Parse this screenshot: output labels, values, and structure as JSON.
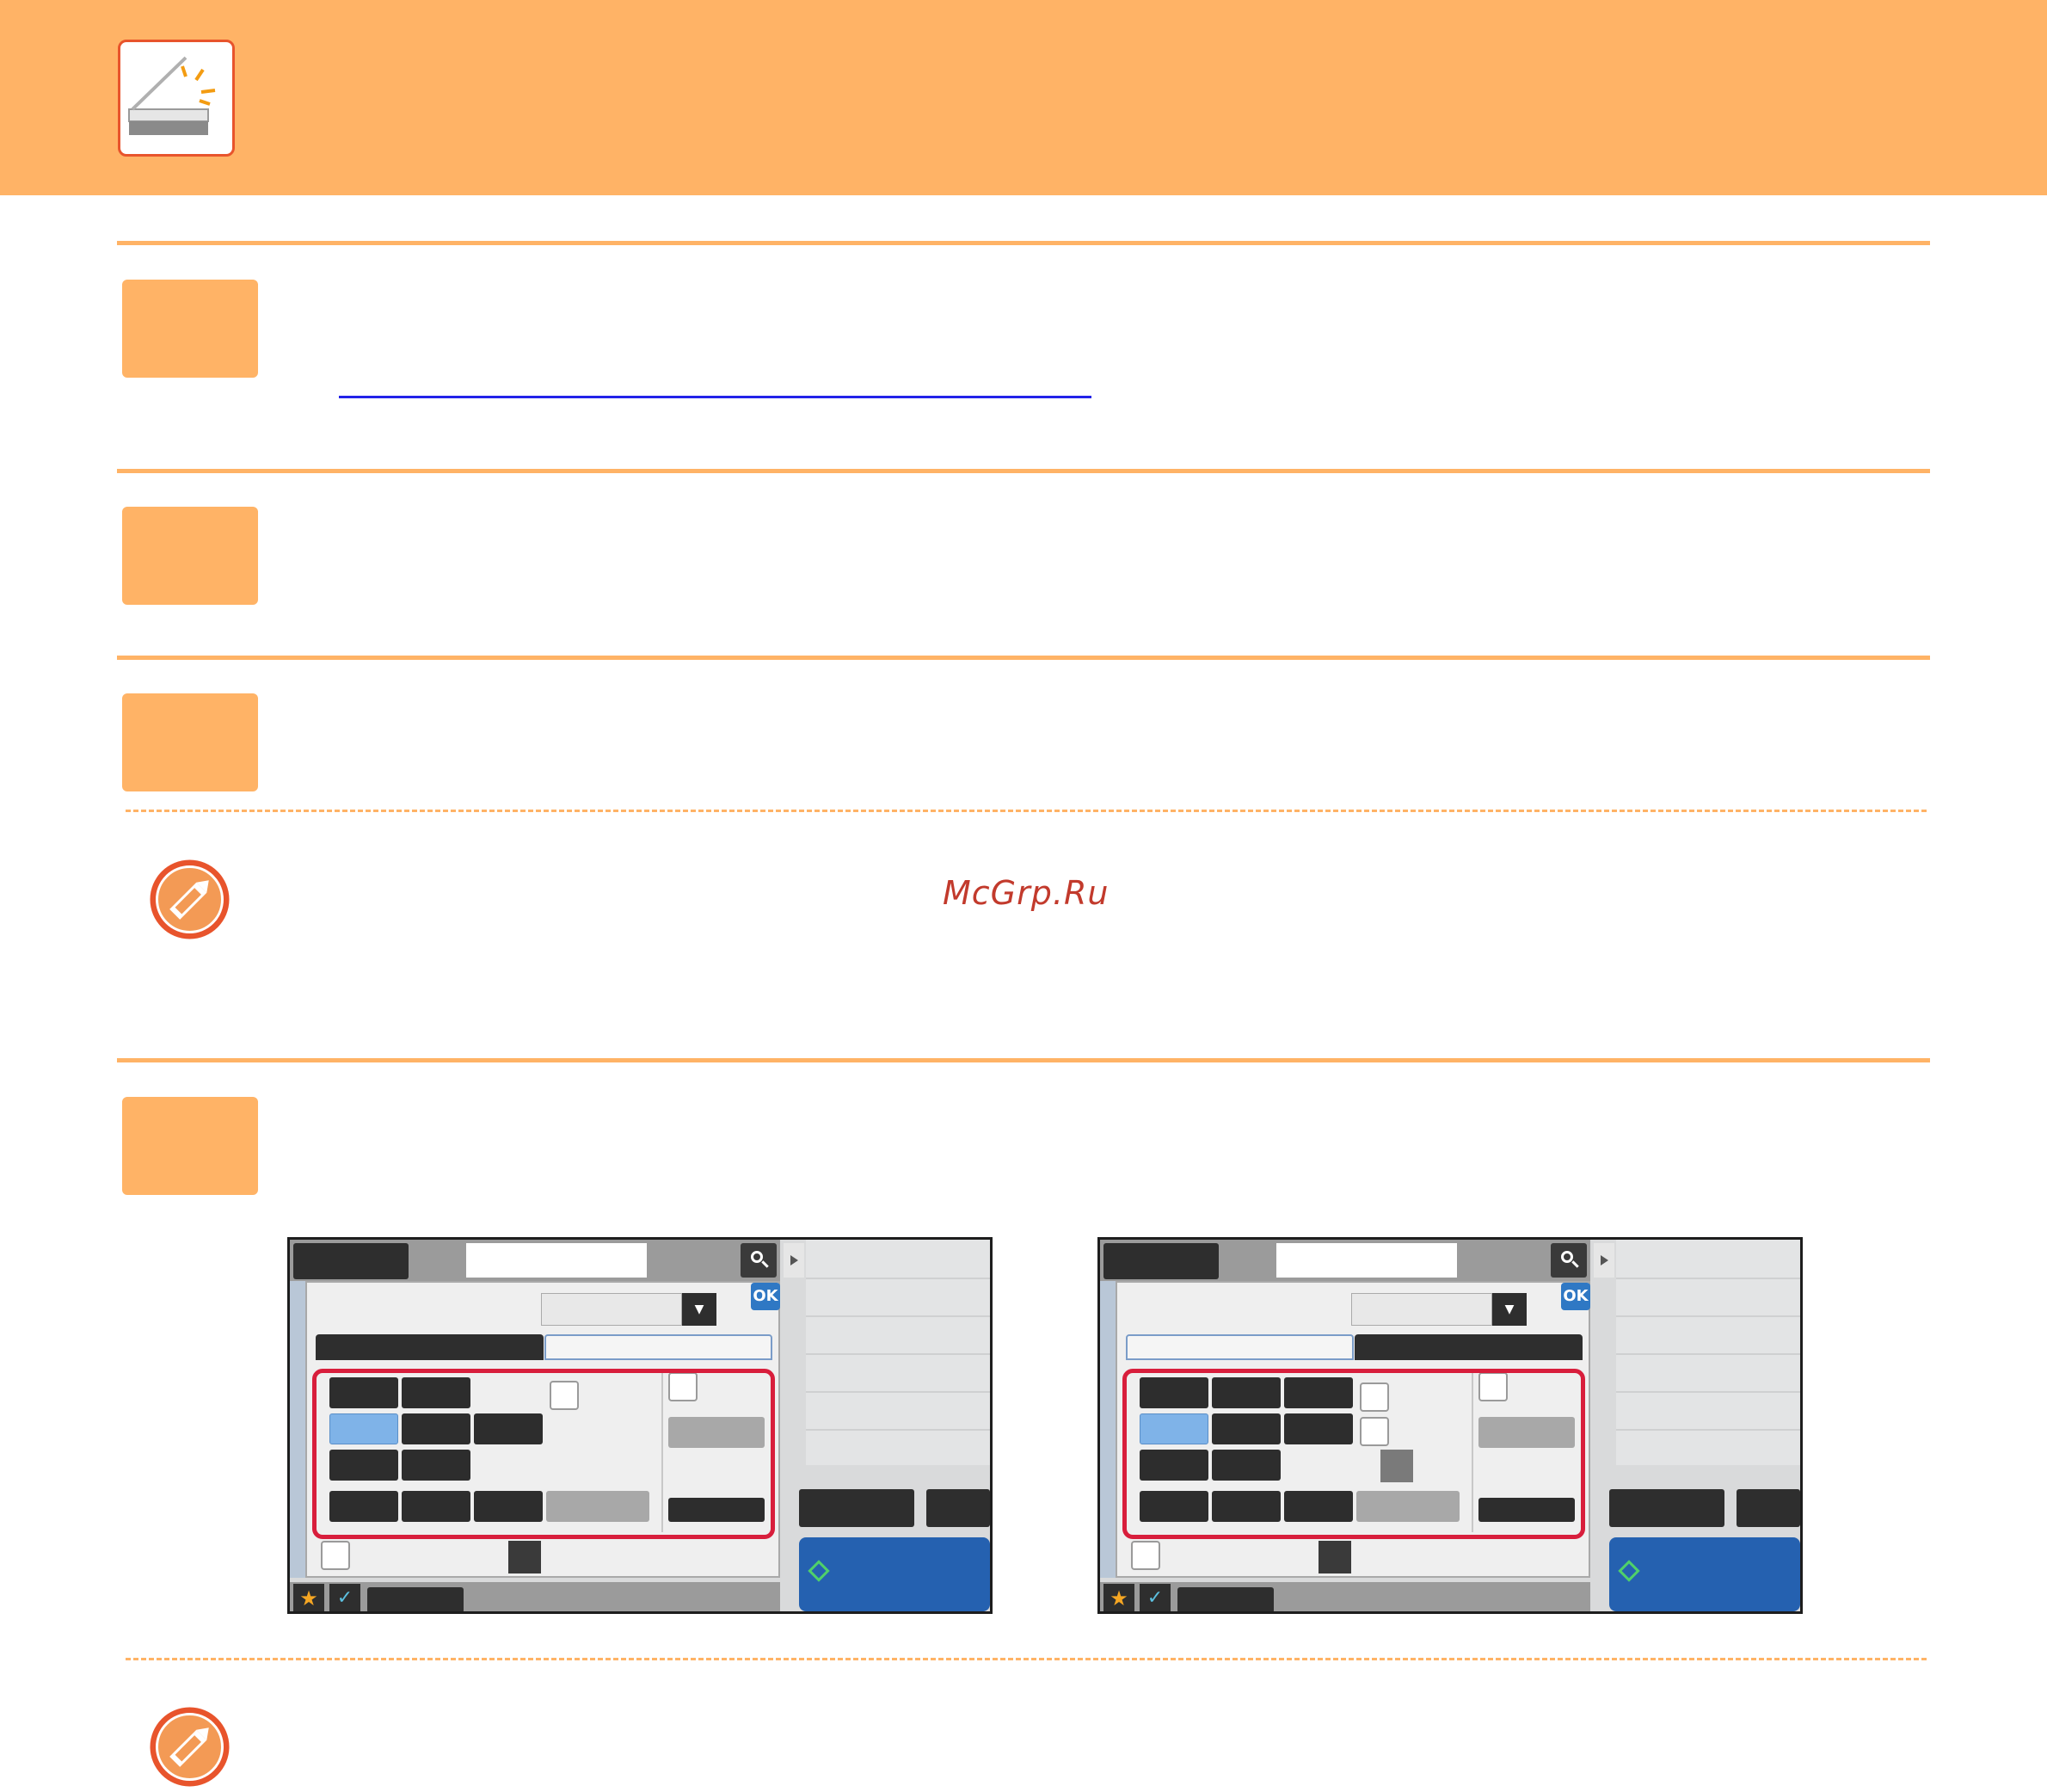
{
  "watermark": {
    "text": "McGrp.Ru"
  },
  "colors": {
    "accent": "#ffb366",
    "highlight_frame": "#d81e3c",
    "link": "#2323e8"
  },
  "icons": {
    "header": "scanner-icon",
    "note": "pencil-note-icon",
    "search": "search-icon",
    "start": "start-diamond-icon",
    "favorite": "star-icon",
    "check": "check-icon"
  },
  "screens": [
    {
      "ok_label": "OK",
      "dropdown_arrow": "▼"
    },
    {
      "ok_label": "OK",
      "dropdown_arrow": "▼"
    }
  ]
}
